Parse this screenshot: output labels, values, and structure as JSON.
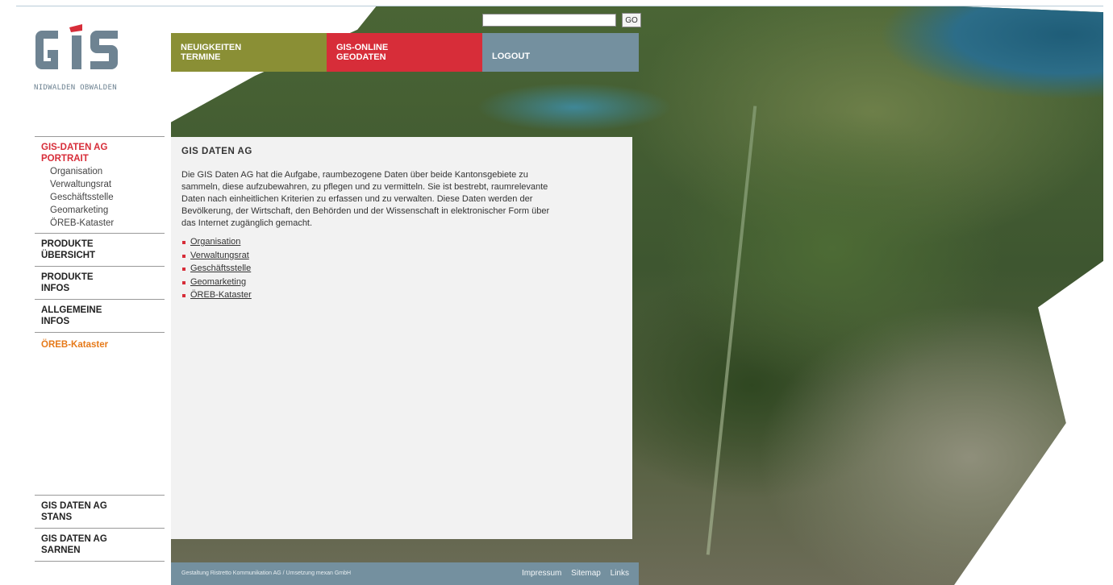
{
  "logo": {
    "letters": "GIS",
    "subtitle": "NIDWALDEN OBWALDEN",
    "colors": {
      "text": "#6e8392",
      "accent": "#d72d39"
    }
  },
  "search": {
    "value": "",
    "placeholder": "",
    "button_label": "GO"
  },
  "topnav": [
    {
      "line1": "NEUIGKEITEN",
      "line2": "TERMINE",
      "color": "#8a8f35"
    },
    {
      "line1": "GIS-ONLINE",
      "line2": "GEODATEN",
      "color": "#d72d39"
    },
    {
      "line1": "LOGOUT",
      "line2": "",
      "color": "#74909f"
    }
  ],
  "sidebar": {
    "sections": [
      {
        "line1": "GIS-DATEN AG",
        "line2": "PORTRAIT",
        "active": true,
        "items": [
          "Organisation",
          "Verwaltungsrat",
          "Geschäftsstelle",
          "Geomarketing",
          "ÖREB-Kataster"
        ]
      },
      {
        "line1": "PRODUKTE",
        "line2": "ÜBERSICHT"
      },
      {
        "line1": "PRODUKTE",
        "line2": "INFOS"
      },
      {
        "line1": "ALLGEMEINE",
        "line2": "INFOS"
      }
    ],
    "highlight_link": "ÖREB-Kataster",
    "bottom_sections": [
      {
        "line1": "GIS DATEN AG",
        "line2": "STANS"
      },
      {
        "line1": "GIS DATEN AG",
        "line2": "SARNEN"
      }
    ]
  },
  "main": {
    "title": "GIS DATEN AG",
    "text": "Die GIS Daten AG hat die Aufgabe, raumbezogene Daten über beide Kantonsgebiete zu sammeln, diese aufzubewahren, zu pflegen und zu vermitteln. Sie ist bestrebt, raumrelevante Daten nach einheitlichen Kriterien zu erfassen und zu verwalten. Diese Daten werden der Bevölkerung, der Wirtschaft, den Behörden und der Wissenschaft in elektronischer Form über das Internet zugänglich gemacht.",
    "links": [
      "Organisation",
      "Verwaltungsrat",
      "Geschäftsstelle",
      "Geomarketing",
      "ÖREB-Kataster"
    ]
  },
  "footer": {
    "credit": "Gestaltung Ristretto Kommunikation AG / Umsetzung mexan GmbH",
    "links": [
      "Impressum",
      "Sitemap",
      "Links"
    ]
  },
  "colors": {
    "olive": "#8a8f35",
    "red": "#d72d39",
    "slate": "#74909f",
    "orange": "#e67a1a",
    "content_bg": "#f2f2f2"
  }
}
